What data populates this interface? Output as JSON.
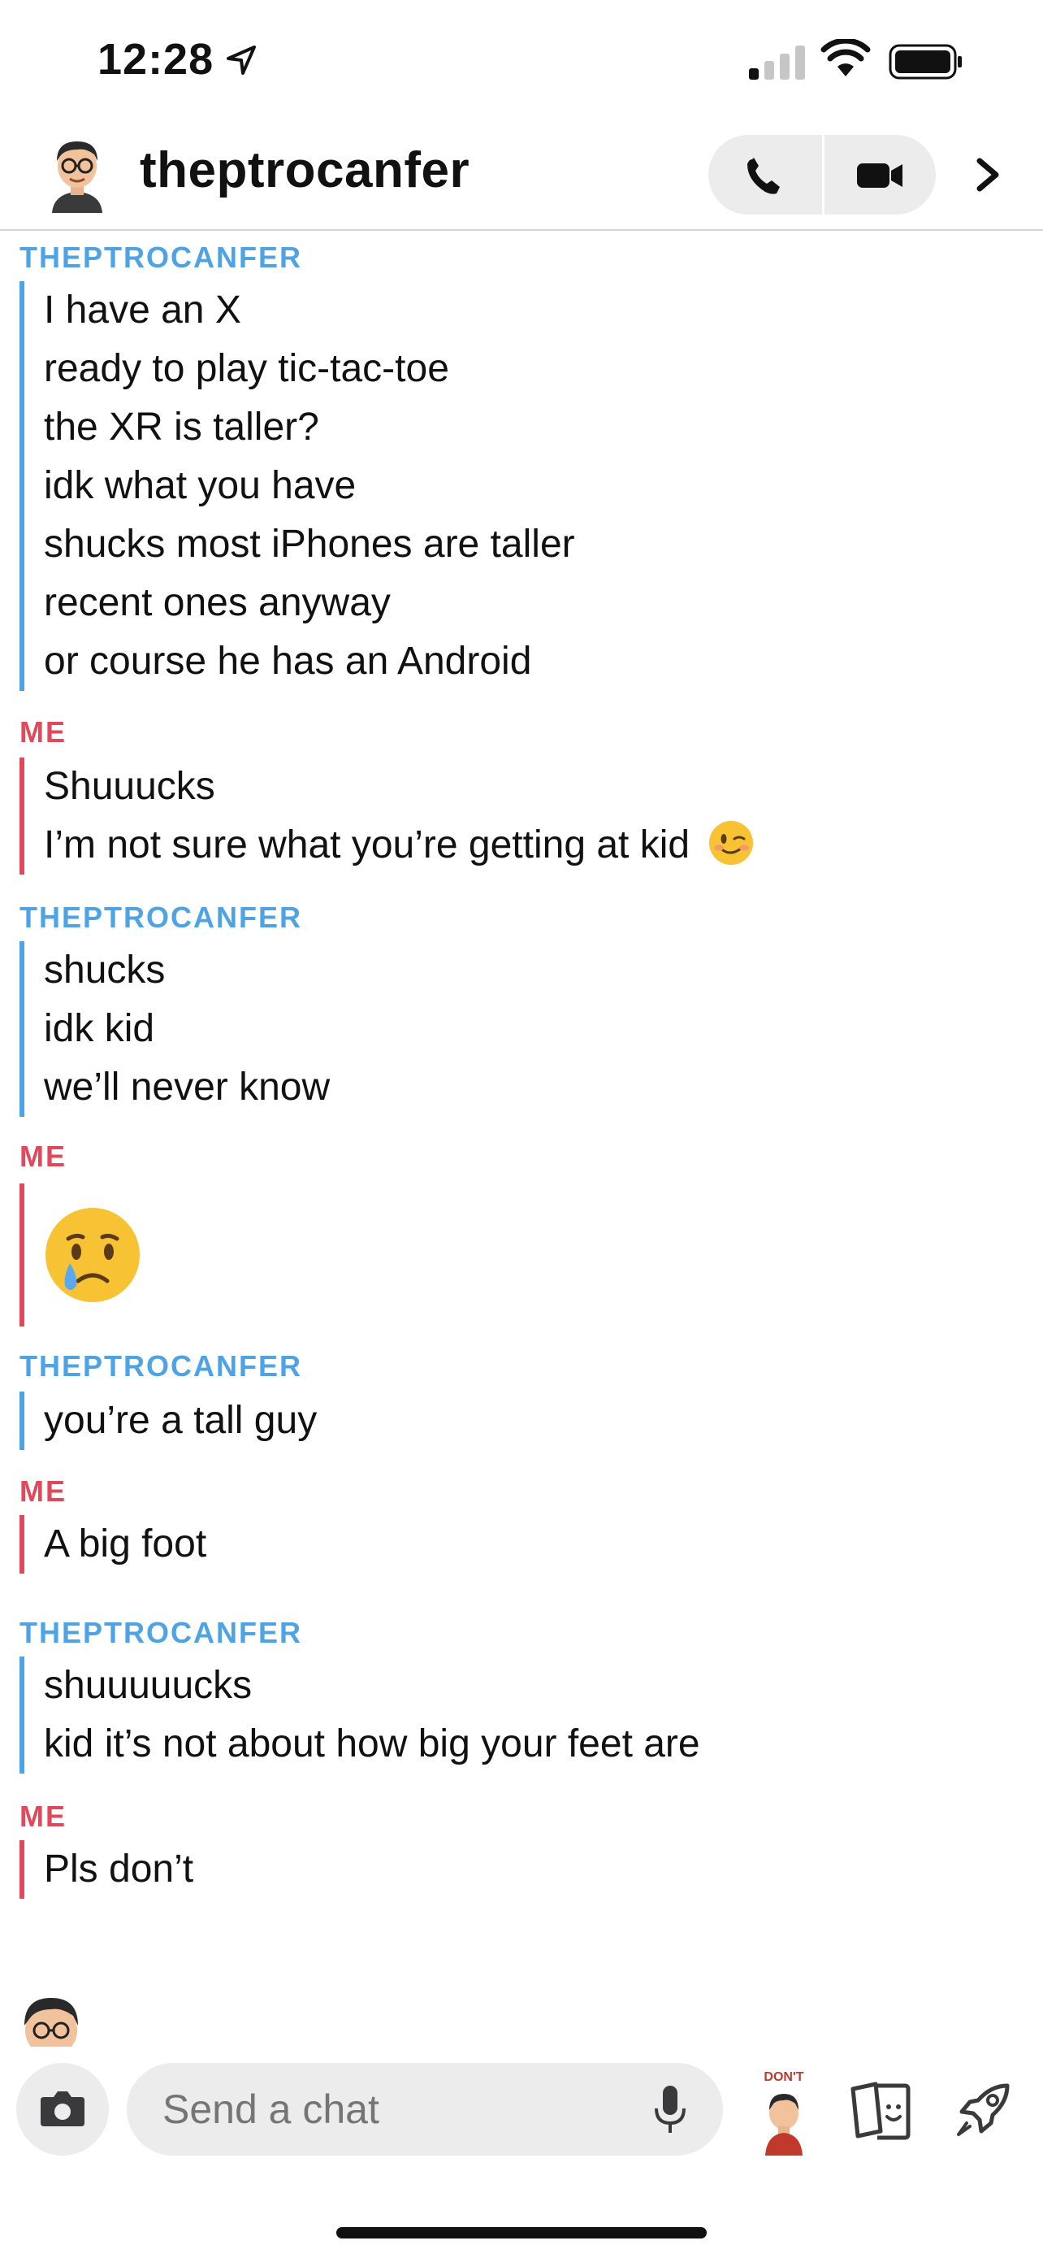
{
  "status_bar": {
    "time": "12:28"
  },
  "header": {
    "title": "theptrocanfer"
  },
  "composer": {
    "placeholder": "Send a chat",
    "bitmoji_sticker_text": "DON'T"
  },
  "messages": [
    {
      "sender": "THEPTROCANFER",
      "lines": [
        "I have an X",
        "ready to play tic-tac-toe",
        "the XR is taller?",
        "idk what you have",
        "shucks most iPhones are taller",
        "recent ones anyway",
        "or course he has an Android"
      ]
    },
    {
      "sender": "ME",
      "lines": [
        "Shuuucks",
        "I’m not sure what you’re getting at kid"
      ],
      "emoji": "winking-face"
    },
    {
      "sender": "THEPTROCANFER",
      "lines": [
        "shucks",
        "idk kid",
        "we’ll never know"
      ]
    },
    {
      "sender": "ME",
      "emoji": "crying-face"
    },
    {
      "sender": "THEPTROCANFER",
      "lines": [
        "you’re a tall guy"
      ]
    },
    {
      "sender": "ME",
      "lines": [
        "A big foot"
      ]
    },
    {
      "sender": "THEPTROCANFER",
      "lines": [
        "shuuuuucks",
        "kid it’s not about how big your feet are"
      ]
    },
    {
      "sender": "ME",
      "lines": [
        "Pls don’t"
      ]
    }
  ],
  "colors": {
    "friend": "#4ea3e4",
    "me": "#e0495a"
  },
  "icons": [
    "location-arrow-icon",
    "signal-icon",
    "wifi-icon",
    "battery-icon",
    "phone-icon",
    "video-icon",
    "chevron-right-icon",
    "camera-icon",
    "microphone-icon",
    "cards-icon",
    "rocket-icon"
  ]
}
